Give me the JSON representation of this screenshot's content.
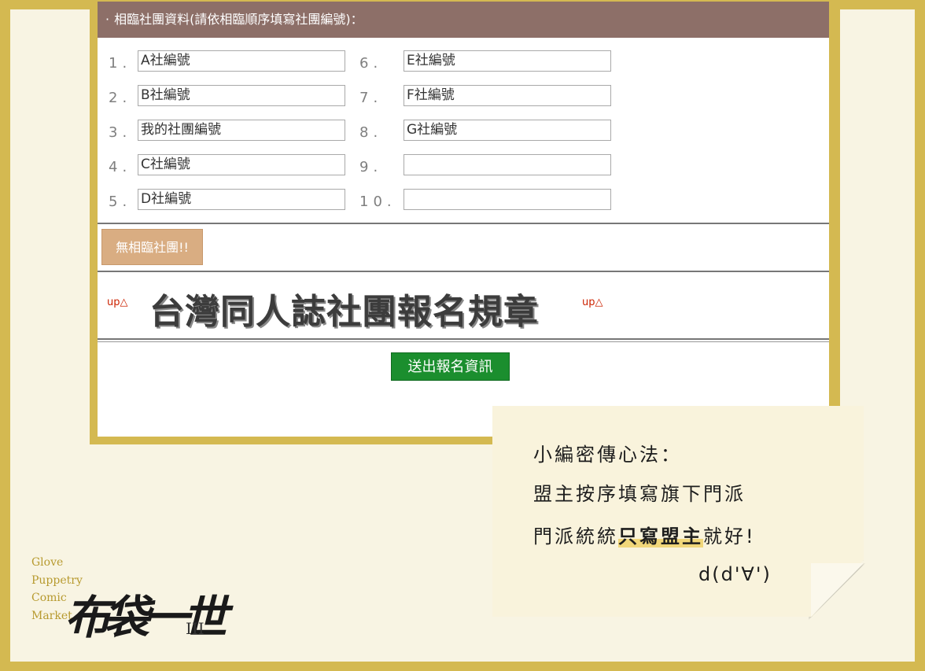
{
  "form": {
    "header": "相臨社團資料(請依相臨順序填寫社團編號)：",
    "header_bullet": "·",
    "rows_left": [
      {
        "num": "1.",
        "value": "A社編號"
      },
      {
        "num": "2.",
        "value": "B社編號"
      },
      {
        "num": "3.",
        "value": "我的社團編號"
      },
      {
        "num": "4.",
        "value": "C社編號"
      },
      {
        "num": "5.",
        "value": "D社編號"
      }
    ],
    "rows_right": [
      {
        "num": "6.",
        "value": "E社編號"
      },
      {
        "num": "7.",
        "value": "F社編號"
      },
      {
        "num": "8.",
        "value": "G社編號"
      },
      {
        "num": "9.",
        "value": ""
      },
      {
        "num": "10.",
        "value": ""
      }
    ],
    "no_neighbor_button": "無相臨社團!!",
    "up_link_left": "up△",
    "up_link_right": "up△",
    "rules_title": "台灣同人誌社團報名規章",
    "submit_button": "送出報名資訊"
  },
  "note": {
    "line1": "小編密傳心法：",
    "line2": "盟主按序填寫旗下門派",
    "line3_before": "門派統統",
    "line3_highlight": "只寫盟主",
    "line3_after": "就好!",
    "line4": "d(d'∀')"
  },
  "logo": {
    "words": [
      "Glove",
      "Puppetry",
      "Comic",
      "Market"
    ],
    "script": "布袋一世",
    "roman": "III"
  },
  "colors": {
    "frame_gold": "#d4b951",
    "header_brown": "#8d6f68",
    "button_tan": "#d9ad82",
    "submit_green": "#1b8e2e",
    "note_paper": "#f9f3dc",
    "highlight": "#f1d77a"
  }
}
